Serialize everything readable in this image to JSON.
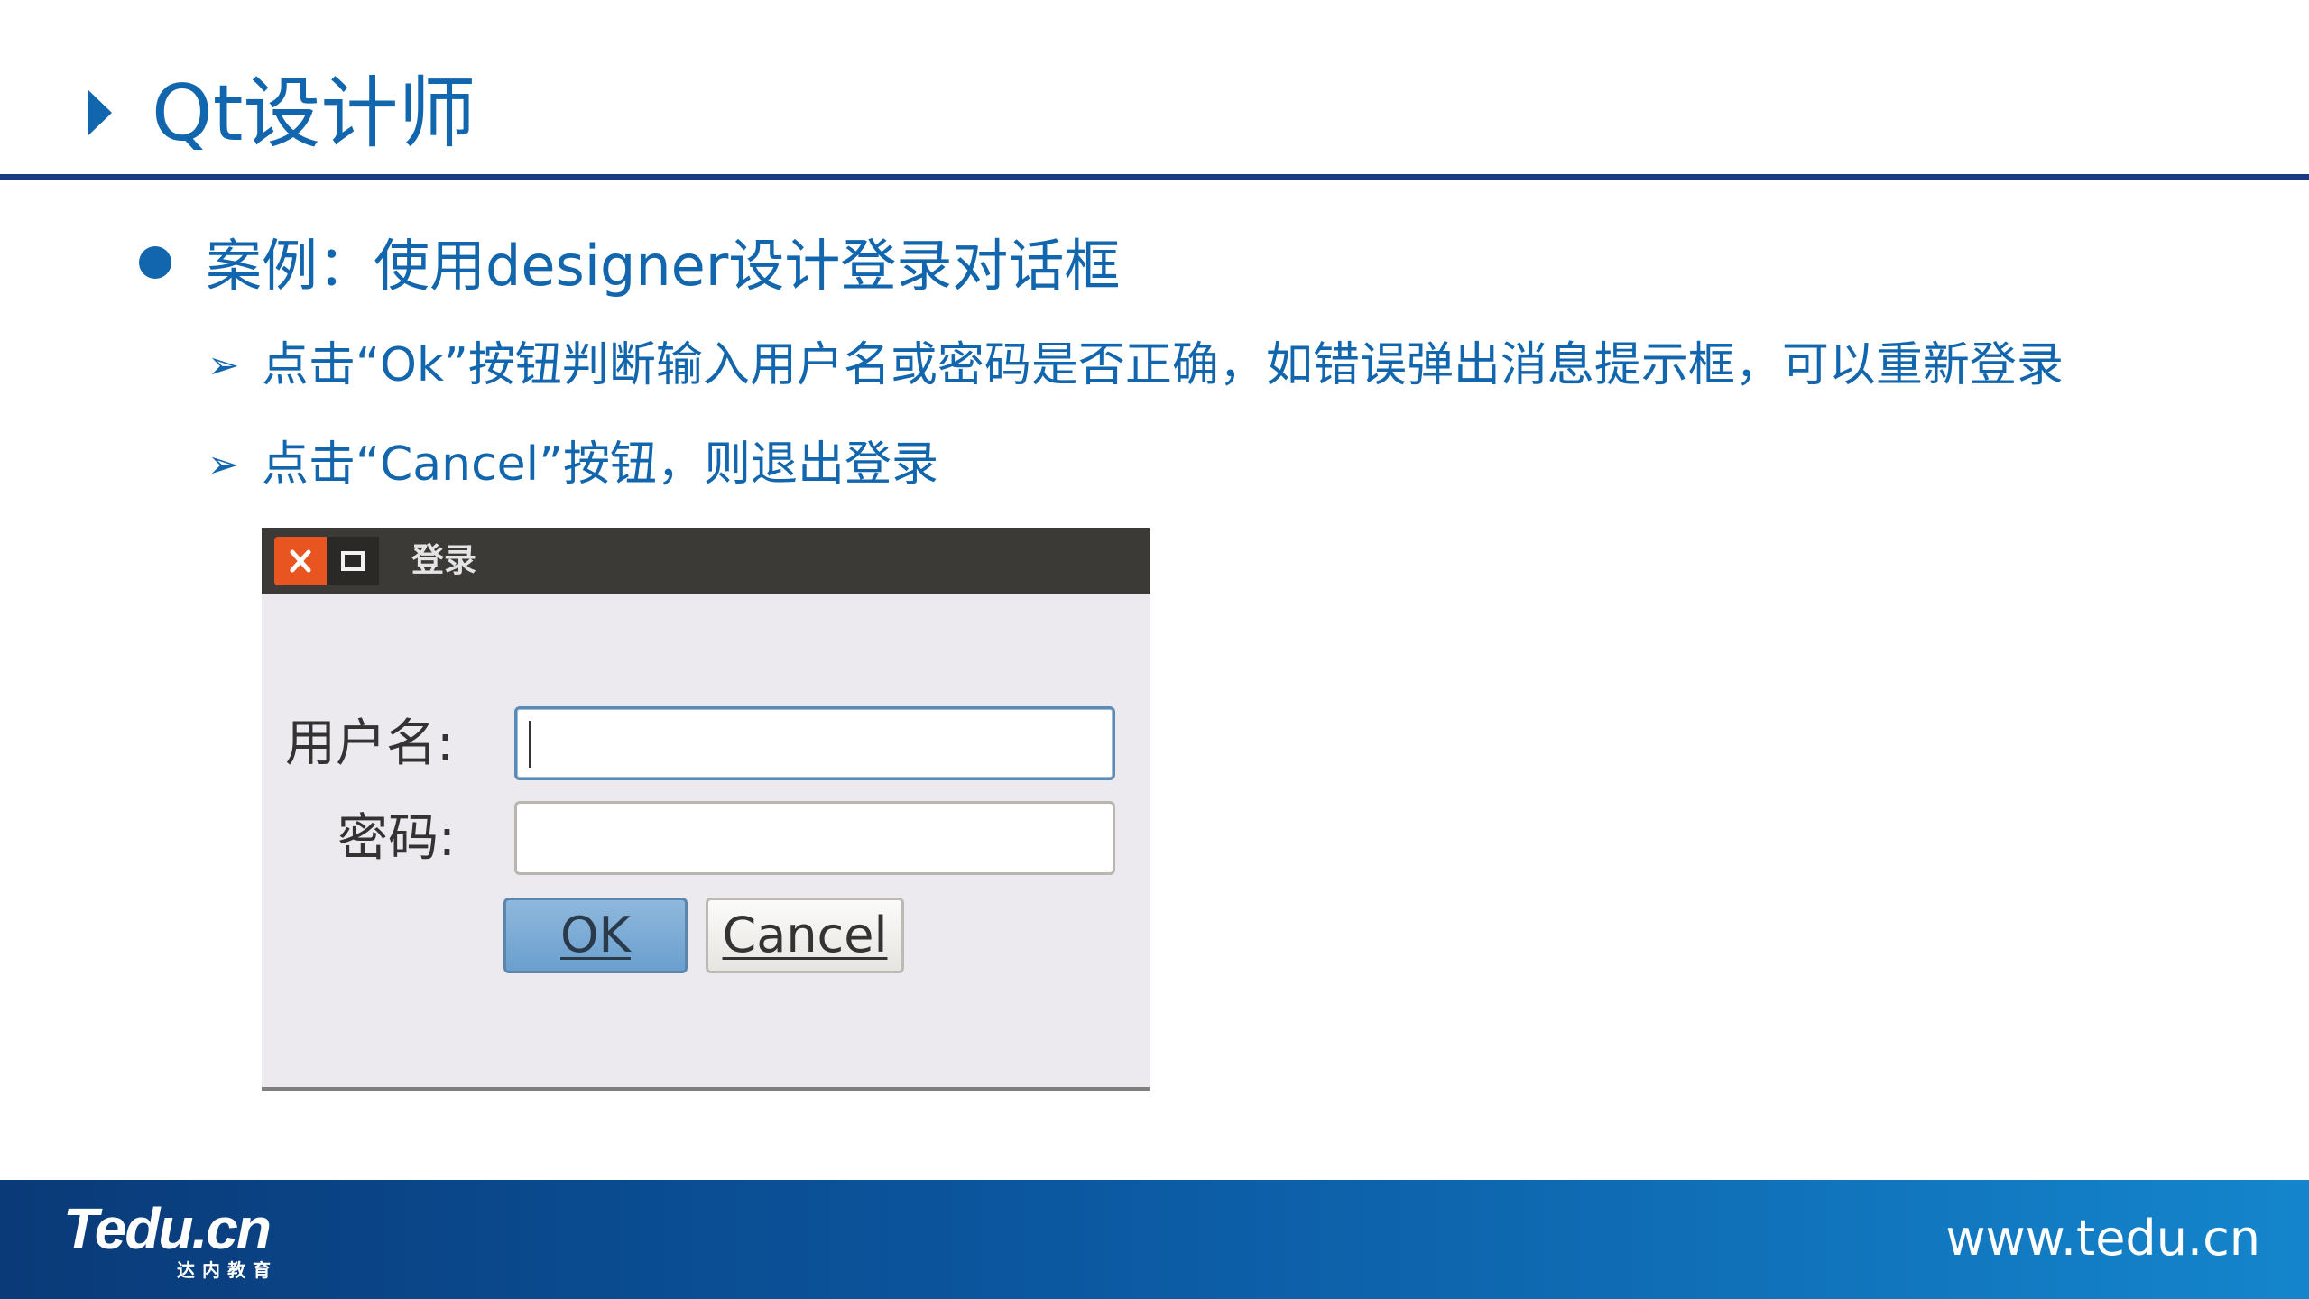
{
  "slide": {
    "title": "Qt设计师",
    "bullet1": "案例：使用designer设计登录对话框",
    "bullets2": [
      "点击“Ok”按钮判断输入用户名或密码是否正确，如错误弹出消息提示框，可以重新登录",
      "点击“Cancel”按钮，则退出登录"
    ],
    "bullet2_marker": "➢"
  },
  "dialog": {
    "title": "登录",
    "username_label": "用户名:",
    "password_label": "密码:",
    "username_value": "",
    "password_value": "",
    "ok_label": "OK",
    "cancel_label": "Cancel",
    "close_icon": "close-icon",
    "maximize_icon": "maximize-icon"
  },
  "footer": {
    "logo_text": "Tedu.cn",
    "logo_subtext": "达内教育",
    "url": "www.tedu.cn"
  },
  "colors": {
    "accent": "#1266ad",
    "rule": "#1c3a82",
    "close_button": "#e95520"
  }
}
